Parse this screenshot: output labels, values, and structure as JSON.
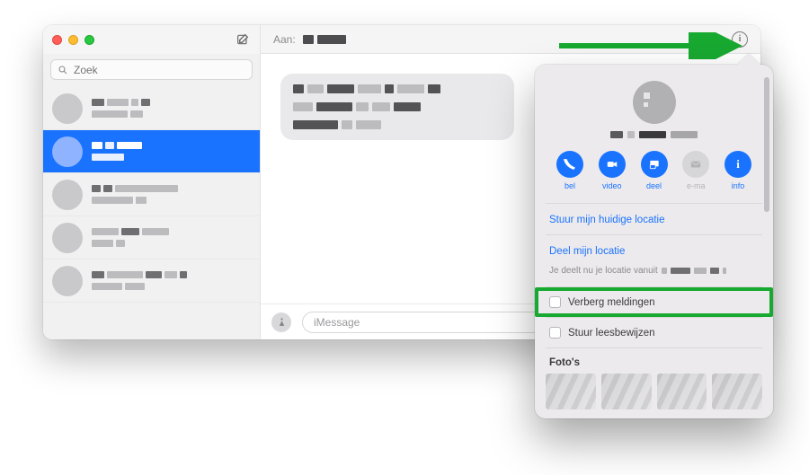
{
  "sidebar": {
    "search_placeholder": "Zoek"
  },
  "header": {
    "to_label": "Aan:"
  },
  "compose": {
    "placeholder": "iMessage"
  },
  "popover": {
    "actions": {
      "call": "bel",
      "video": "video",
      "share": "deel",
      "email": "e-ma",
      "info": "info"
    },
    "send_current_location": "Stuur mijn huidige locatie",
    "share_my_location": "Deel mijn locatie",
    "sharing_note_prefix": "Je deelt nu je locatie vanuit",
    "hide_notifications": "Verberg meldingen",
    "send_read_receipts": "Stuur leesbewijzen",
    "photos_title": "Foto's"
  }
}
